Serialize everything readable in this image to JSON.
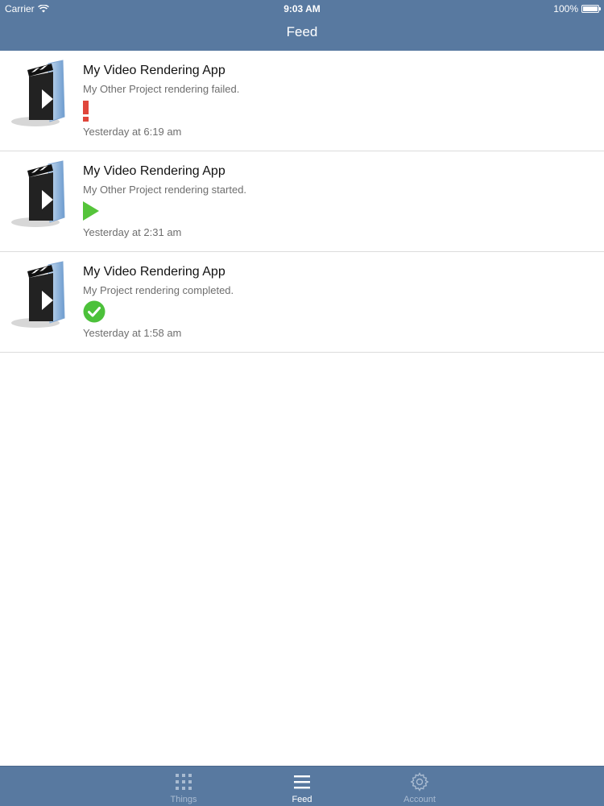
{
  "status_bar": {
    "carrier": "Carrier",
    "time": "9:03 AM",
    "battery": "100%"
  },
  "nav": {
    "title": "Feed"
  },
  "feed": {
    "items": [
      {
        "title": "My Video Rendering App",
        "message": "My Other Project rendering failed.",
        "status_icon": "error-exclamation-icon",
        "timestamp": "Yesterday at 6:19 am"
      },
      {
        "title": "My Video Rendering App",
        "message": "My Other Project rendering started.",
        "status_icon": "play-icon",
        "timestamp": "Yesterday at 2:31 am"
      },
      {
        "title": "My Video Rendering App",
        "message": "My Project rendering completed.",
        "status_icon": "check-circle-icon",
        "timestamp": "Yesterday at 1:58 am"
      }
    ]
  },
  "tabbar": {
    "tabs": [
      {
        "label": "Things",
        "icon": "grid-icon",
        "active": false
      },
      {
        "label": "Feed",
        "icon": "list-icon",
        "active": true
      },
      {
        "label": "Account",
        "icon": "gear-icon",
        "active": false
      }
    ]
  },
  "colors": {
    "bar_background": "#5879a0",
    "error": "#e0463b",
    "play": "#55c43a",
    "success": "#4cc13a"
  }
}
